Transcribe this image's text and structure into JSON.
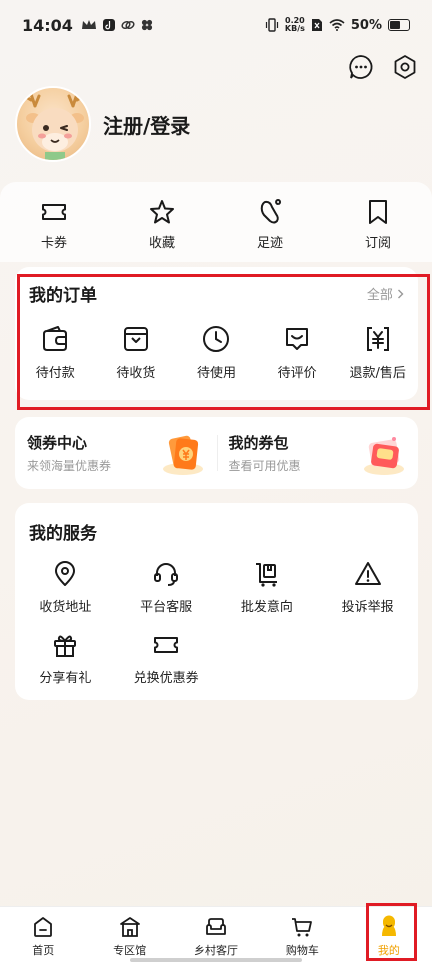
{
  "status": {
    "time": "14:04",
    "netspeed_value": "0.20",
    "netspeed_unit": "KB/s",
    "battery": "50%"
  },
  "profile": {
    "login_label": "注册/登录"
  },
  "quick": [
    {
      "label": "卡券",
      "icon": "ticket-icon"
    },
    {
      "label": "收藏",
      "icon": "star-icon"
    },
    {
      "label": "足迹",
      "icon": "footprint-icon"
    },
    {
      "label": "订阅",
      "icon": "bookmark-icon"
    }
  ],
  "orders": {
    "title": "我的订单",
    "all_label": "全部",
    "items": [
      {
        "label": "待付款",
        "icon": "wallet-icon"
      },
      {
        "label": "待收货",
        "icon": "inbox-icon"
      },
      {
        "label": "待使用",
        "icon": "clock-icon"
      },
      {
        "label": "待评价",
        "icon": "comment-icon"
      },
      {
        "label": "退款/售后",
        "icon": "refund-icon"
      }
    ]
  },
  "coupons": {
    "center": {
      "title": "领券中心",
      "subtitle": "来领海量优惠券"
    },
    "mine": {
      "title": "我的券包",
      "subtitle": "查看可用优惠"
    }
  },
  "services": {
    "title": "我的服务",
    "items": [
      {
        "label": "收货地址",
        "icon": "location-icon"
      },
      {
        "label": "平台客服",
        "icon": "headset-icon"
      },
      {
        "label": "批发意向",
        "icon": "cart-box-icon"
      },
      {
        "label": "投诉举报",
        "icon": "warning-icon"
      },
      {
        "label": "分享有礼",
        "icon": "gift-icon"
      },
      {
        "label": "兑换优惠券",
        "icon": "ticket-icon"
      }
    ]
  },
  "tabs": [
    {
      "label": "首页",
      "icon": "home-icon"
    },
    {
      "label": "专区馆",
      "icon": "pavilion-icon"
    },
    {
      "label": "乡村客厅",
      "icon": "sofa-icon"
    },
    {
      "label": "购物车",
      "icon": "cart-icon"
    },
    {
      "label": "我的",
      "icon": "profile-icon"
    }
  ],
  "colors": {
    "accent": "#f0a000",
    "annotation": "#e01b24"
  }
}
